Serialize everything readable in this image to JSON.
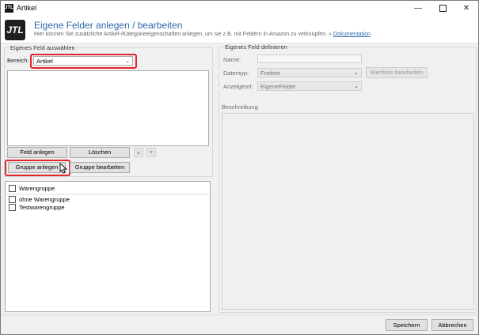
{
  "window": {
    "title": "Artikel",
    "icon_text": "JTL"
  },
  "header": {
    "logo_text": "JTL",
    "title": "Eigene Felder anlegen / bearbeiten",
    "subtitle": "Hier können Sie zusätzliche Artikel-/Kategorieeigenschaften anlegen, um sie z.B. mit Feldern in Amazon zu verknüpfen.",
    "link_prefix": "»",
    "link_text": "Dokumentation"
  },
  "left": {
    "group_title": "Eigenes Feld auswählen",
    "bereich_label": "Bereich:",
    "bereich_value": "Artikel",
    "buttons": {
      "feld_anlegen": "Feld anlegen",
      "loeschen": "Löschen",
      "gruppe_anlegen": "Gruppe anlegen",
      "gruppe_bearbeiten": "Gruppe bearbeiten"
    },
    "tree": [
      "Warengruppe",
      "ohne Warengruppe",
      "Testwarengruppe"
    ]
  },
  "right": {
    "group_title": "Eigenes Feld definieren",
    "name_label": "Name:",
    "datentyp_label": "Datentyp:",
    "datentyp_value": "Freitext",
    "wertliste_button": "Wertliste bearbeiten",
    "anzeigeort_label": "Anzeigeort:",
    "anzeigeort_value": "EigeneFelder",
    "beschreibung_label": "Beschreibung"
  },
  "footer": {
    "save": "Speichern",
    "cancel": "Abbrechen"
  },
  "colors": {
    "highlight": "#e0252b",
    "title_blue": "#2f66a8"
  }
}
